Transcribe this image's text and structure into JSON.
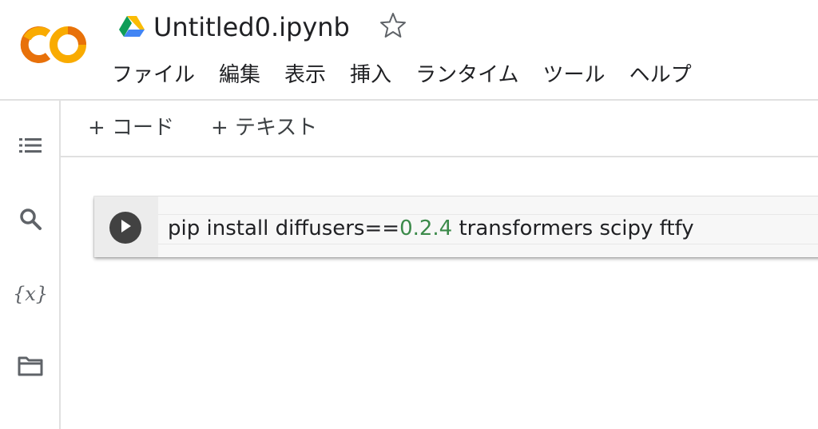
{
  "header": {
    "title": "Untitled0.ipynb",
    "logo_text": "CO",
    "icons": {
      "drive": "google-drive-icon",
      "star": "star-outline-icon"
    },
    "menu": [
      "ファイル",
      "編集",
      "表示",
      "挿入",
      "ランタイム",
      "ツール",
      "ヘルプ"
    ]
  },
  "sidebar": {
    "items": [
      {
        "name": "table-of-contents",
        "icon": "list-icon"
      },
      {
        "name": "search",
        "icon": "search-icon"
      },
      {
        "name": "variables",
        "icon": "variables-icon",
        "glyph": "{x}"
      },
      {
        "name": "files",
        "icon": "folder-icon"
      }
    ]
  },
  "toolbar": {
    "add_code": "+ コード",
    "add_text": "+ テキスト"
  },
  "cell": {
    "code_parts": [
      "pip install diffusers==",
      "0.2.4",
      " transformers scipy ftfy"
    ],
    "run_icon": "play-icon"
  },
  "colors": {
    "logo_orange": "#F9AB00",
    "logo_dark_orange": "#E8710A",
    "number_token": "#3b8a4a",
    "run_button": "#424242"
  }
}
